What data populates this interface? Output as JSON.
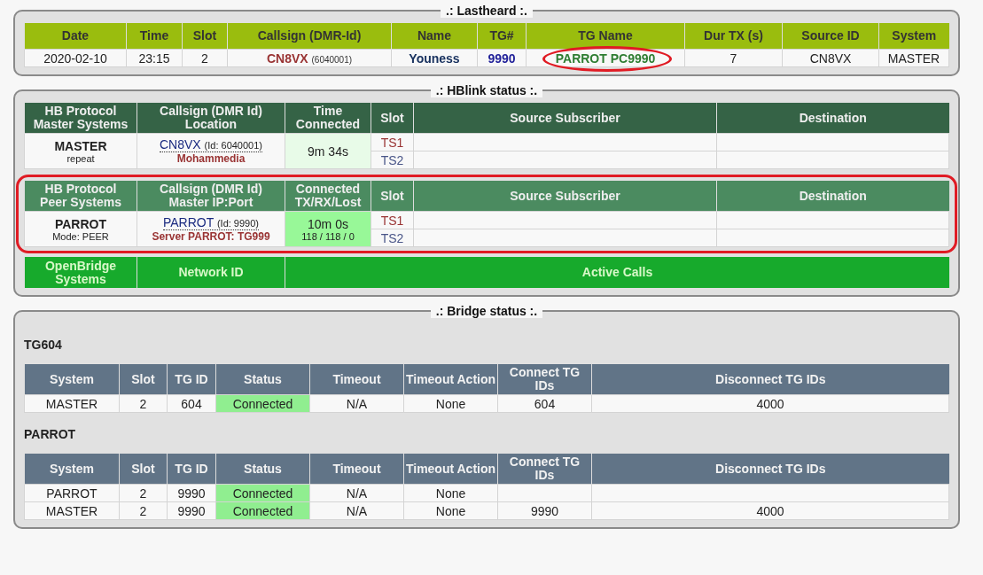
{
  "lastheard": {
    "title": ".: Lastheard :.",
    "columns": [
      "Date",
      "Time",
      "Slot",
      "Callsign (DMR-Id)",
      "Name",
      "TG#",
      "TG Name",
      "Dur TX (s)",
      "Source ID",
      "System"
    ],
    "rows": [
      {
        "date": "2020-02-10",
        "time": "23:15",
        "slot": "2",
        "callsign": "CN8VX",
        "dmr_id": "(6040001)",
        "name": "Youness",
        "tg": "9990",
        "tg_name": "PARROT PC9990",
        "tg_name_circled": true,
        "duration": "7",
        "source_id": "CN8VX",
        "system": "MASTER"
      }
    ]
  },
  "hblink": {
    "title": ".: HBlink status :.",
    "master": {
      "circled": false,
      "columns": [
        "HB Protocol\nMaster Systems",
        "Callsign (DMR Id)\nLocation",
        "Time\nConnected",
        "Slot",
        "Source Subscriber",
        "Destination"
      ],
      "rows": [
        {
          "system": "MASTER",
          "mode": "repeat",
          "callsign": "CN8VX",
          "id": "(Id: 6040001)",
          "location": "Mohammedia",
          "connected": "9m 34s",
          "slots": [
            {
              "slot": "TS1",
              "color": "#993333"
            },
            {
              "slot": "TS2",
              "color": "#4a5688"
            }
          ]
        }
      ]
    },
    "peer": {
      "circled": true,
      "columns": [
        "HB Protocol\nPeer Systems",
        "Callsign (DMR Id)\nMaster IP:Port",
        "Connected\nTX/RX/Lost",
        "Slot",
        "Source Subscriber",
        "Destination"
      ],
      "rows": [
        {
          "system": "PARROT",
          "mode": "Mode: PEER",
          "callsign": "PARROT",
          "id": "(Id: 9990)",
          "location": "Server PARROT: TG999",
          "connected": "10m 0s",
          "counts": "118 / 118 / 0",
          "slots": [
            {
              "slot": "TS1",
              "color": "#993333"
            },
            {
              "slot": "TS2",
              "color": "#4a5688"
            }
          ]
        }
      ]
    },
    "openbridge": {
      "columns": [
        "OpenBridge\nSystems",
        "Network ID",
        "Active Calls"
      ]
    }
  },
  "bridge": {
    "title": ".: Bridge status :.",
    "groups": [
      {
        "name": "TG604",
        "columns": [
          "System",
          "Slot",
          "TG ID",
          "Status",
          "Timeout",
          "Timeout Action",
          "Connect TG\nIDs",
          "Disconnect TG IDs"
        ],
        "rows": [
          {
            "system": "MASTER",
            "slot": "2",
            "tg_id": "604",
            "status": "Connected",
            "connected": true,
            "timeout": "N/A",
            "timeout_action": "None",
            "connect_tg_ids": "604",
            "disconnect_tg_ids": "4000"
          }
        ]
      },
      {
        "name": "PARROT",
        "columns": [
          "System",
          "Slot",
          "TG ID",
          "Status",
          "Timeout",
          "Timeout Action",
          "Connect TG\nIDs",
          "Disconnect TG IDs"
        ],
        "rows": [
          {
            "system": "PARROT",
            "slot": "2",
            "tg_id": "9990",
            "status": "Connected",
            "connected": true,
            "timeout": "N/A",
            "timeout_action": "None"
          },
          {
            "system": "MASTER",
            "slot": "2",
            "tg_id": "9990",
            "status": "Connected",
            "connected": true,
            "timeout": "N/A",
            "timeout_action": "None",
            "connect_tg_ids": "9990",
            "disconnect_tg_ids": "4000"
          }
        ]
      }
    ]
  }
}
